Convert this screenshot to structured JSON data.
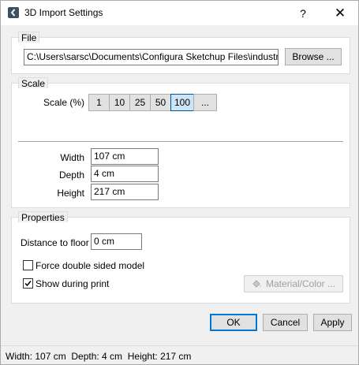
{
  "window": {
    "title": "3D Import Settings",
    "help_glyph": "?",
    "close_glyph": "✕"
  },
  "file": {
    "legend": "File",
    "path": "C:\\Users\\sarsc\\Documents\\Configura Sketchup Files\\industrial_wir",
    "browse_label": "Browse ..."
  },
  "scale": {
    "legend": "Scale",
    "label": "Scale (%)",
    "options": [
      "1",
      "10",
      "25",
      "50",
      "100",
      "..."
    ],
    "selected": "100",
    "width_label": "Width",
    "width_value": "107 cm",
    "depth_label": "Depth",
    "depth_value": "4 cm",
    "height_label": "Height",
    "height_value": "217 cm"
  },
  "properties": {
    "legend": "Properties",
    "distance_label": "Distance to floor",
    "distance_value": "0 cm",
    "double_sided_label": "Force double sided model",
    "double_sided_checked": false,
    "show_print_label": "Show during print",
    "show_print_checked": true,
    "material_label": "Material/Color ..."
  },
  "buttons": {
    "ok": "OK",
    "cancel": "Cancel",
    "apply": "Apply"
  },
  "status": {
    "text": "Width: 107 cm  Depth: 4 cm  Height: 217 cm"
  },
  "colors": {
    "accent": "#0078d7",
    "selected_bg": "#cce4f7"
  }
}
